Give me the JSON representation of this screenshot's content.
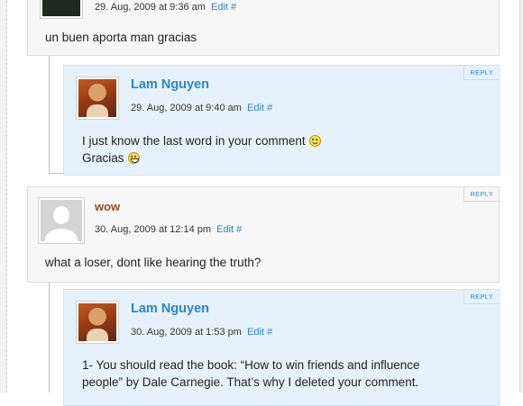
{
  "comments": [
    {
      "date": "29. Aug, 2009 at 9:36 am",
      "edit": "Edit #",
      "text": "un buen aporta man gracias"
    },
    {
      "name": "Lam Nguyen",
      "date": "29. Aug, 2009 at 9:40 am",
      "edit": "Edit #",
      "reply": "REPLY",
      "line1": "I just know the last word in your comment",
      "line2": "Gracias"
    },
    {
      "name": "wow",
      "date": "30. Aug, 2009 at 12:14 pm",
      "edit": "Edit #",
      "reply": "REPLY",
      "text": "what a loser, dont like hearing the truth?"
    },
    {
      "name": "Lam Nguyen",
      "date": "30. Aug, 2009 at 1:53 pm",
      "edit": "Edit #",
      "reply": "REPLY",
      "line1": "1- You should read the book: “How to win friends and influence",
      "line2": "people” by Dale Carnegie. That’s why I deleted your comment."
    }
  ],
  "icons": {
    "smile": "smile-emoticon-icon",
    "grin": "grin-emoticon-icon",
    "default_avatar": "default-avatar-icon"
  },
  "colors": {
    "link": "#2a86c5",
    "visitor_name": "#a3402a",
    "author_bg": "#e6f2fb",
    "comment_bg": "#f7f7f7"
  }
}
